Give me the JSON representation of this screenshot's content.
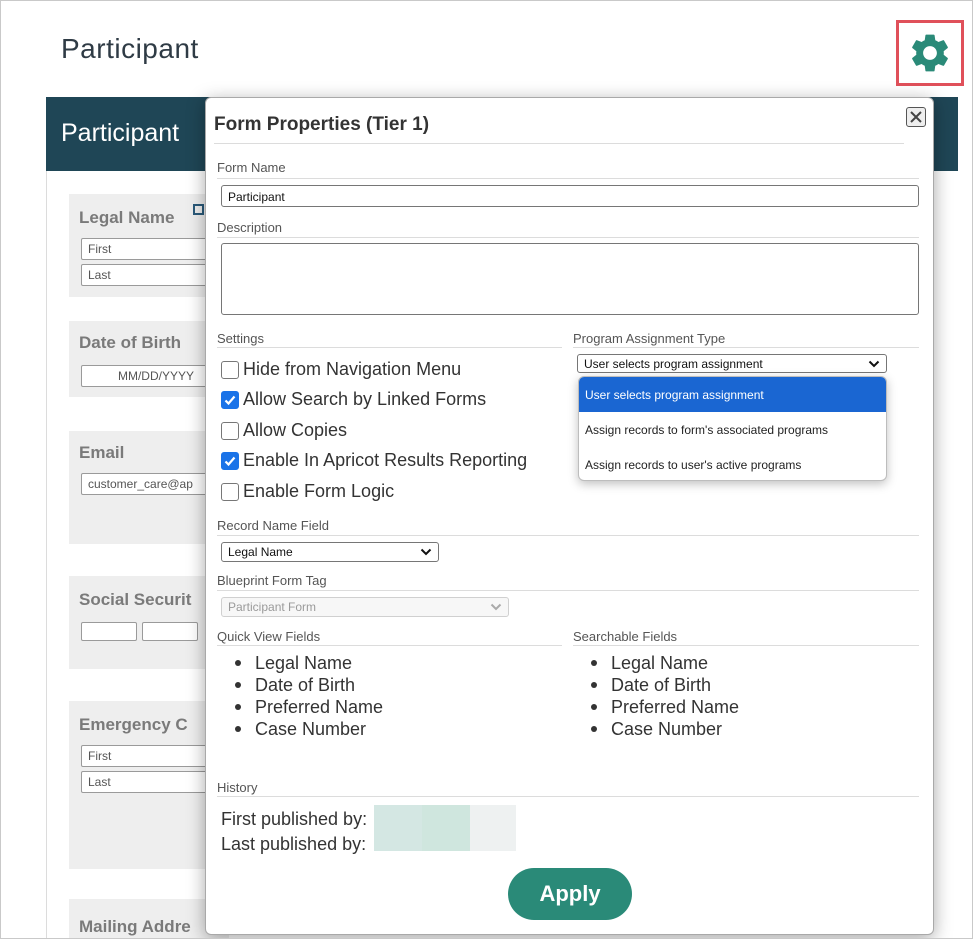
{
  "page": {
    "title": "Participant",
    "header_title": "Participant",
    "accent_color": "#2a8a78",
    "header_color": "#1f4656"
  },
  "background_form": {
    "legal_name_label": "Legal Name",
    "first_placeholder": "First",
    "last_placeholder": "Last",
    "dob_label": "Date of Birth",
    "dob_placeholder": "MM/DD/YYYY",
    "email_label": "Email",
    "email_value": "customer_care@ap",
    "ssn_label": "Social Securit",
    "emergency_label": "Emergency C",
    "emergency_first": "First",
    "emergency_last": "Last",
    "mailing_label": "Mailing Addre"
  },
  "modal": {
    "title": "Form Properties (Tier 1)",
    "form_name_label": "Form Name",
    "form_name_value": "Participant",
    "description_label": "Description",
    "description_value": "",
    "settings_label": "Settings",
    "settings": [
      {
        "label": "Hide from Navigation Menu",
        "checked": false
      },
      {
        "label": "Allow Search by Linked Forms",
        "checked": true
      },
      {
        "label": "Allow Copies",
        "checked": false
      },
      {
        "label": "Enable In Apricot Results Reporting",
        "checked": true
      },
      {
        "label": "Enable Form Logic",
        "checked": false
      }
    ],
    "program_assignment_label": "Program Assignment Type",
    "program_assignment_value": "User selects program assignment",
    "program_assignment_options": [
      "User selects program assignment",
      "Assign records to form's associated programs",
      "Assign records to user's active programs"
    ],
    "record_name_label": "Record Name Field",
    "record_name_value": "Legal Name",
    "blueprint_label": "Blueprint Form Tag",
    "blueprint_value": "Participant Form",
    "quick_view_label": "Quick View Fields",
    "quick_view_fields": [
      "Legal Name",
      "Date of Birth",
      "Preferred Name",
      "Case Number"
    ],
    "searchable_label": "Searchable Fields",
    "searchable_fields": [
      "Legal Name",
      "Date of Birth",
      "Preferred Name",
      "Case Number"
    ],
    "history_label": "History",
    "first_published_label": "First published by:",
    "last_published_label": "Last published by:",
    "apply_label": "Apply"
  }
}
